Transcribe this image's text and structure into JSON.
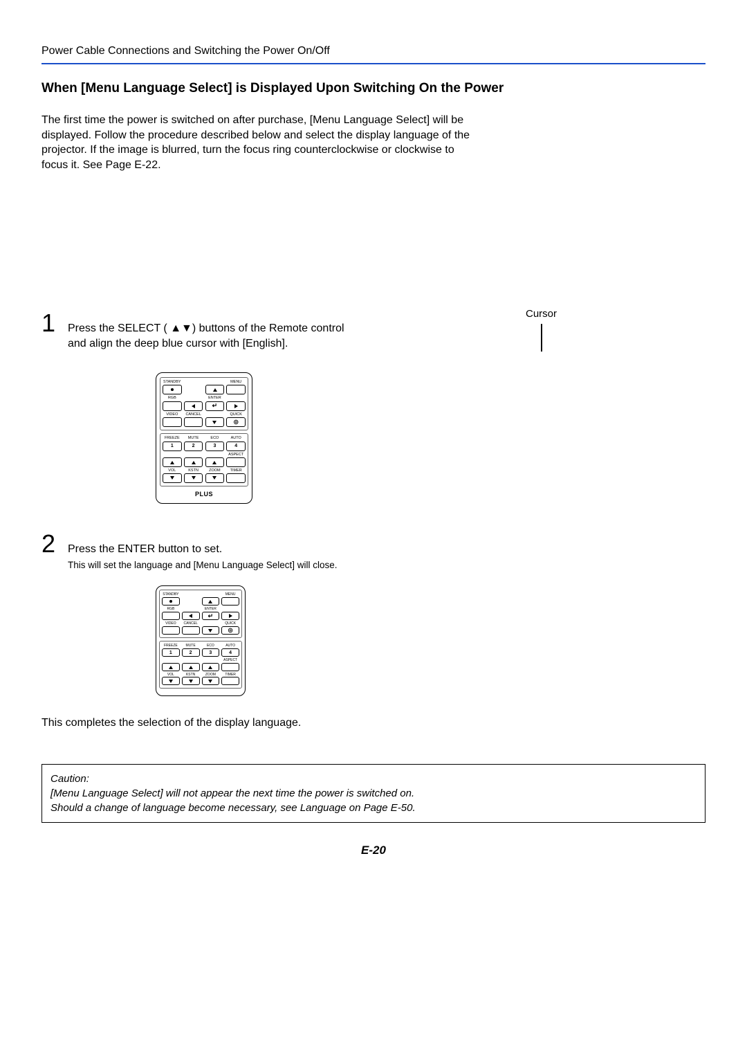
{
  "header": "Power Cable Connections and Switching the Power On/Off",
  "title": "When [Menu Language Select] is Displayed Upon Switching On the Power",
  "intro": "The first time the power is switched on after purchase, [Menu Language Select] will be displayed. Follow the procedure described below and select the display language of the projector.\nIf the image is blurred, turn the focus ring counterclockwise or clockwise to focus it. See Page E-22.",
  "cursor_label": "Cursor",
  "steps": {
    "s1": {
      "num": "1",
      "text": "Press the SELECT ( ▲▼) buttons of the Remote control and align the deep blue cursor with [English]."
    },
    "s2": {
      "num": "2",
      "text": "Press the ENTER button to set.",
      "sub": "This will set the language and [Menu Language Select] will close."
    }
  },
  "remote": {
    "standby": "STANDBY",
    "menu": "MENU",
    "rgb": "RGB",
    "enter": "ENTER",
    "video": "VIDEO",
    "cancel": "CANCEL",
    "quick": "QUICK",
    "freeze": "FREEZE",
    "mute": "MUTE",
    "eco": "ECO",
    "auto": "AUTO",
    "aspect": "ASPECT",
    "vol": "VOL",
    "kstn": "KSTN",
    "zoom": "ZOOM",
    "timer": "TIMER",
    "n1": "1",
    "n2": "2",
    "n3": "3",
    "n4": "4",
    "brand": "PLUS"
  },
  "completion": "This completes the selection of the display language.",
  "caution": {
    "title": "Caution:",
    "line1": "[Menu Language Select] will not appear the next time the power is switched on.",
    "line2a": "Should a change of language become necessary, see",
    "line2b": "Language",
    "line2c": "on Page E-50."
  },
  "page_number": "E-20"
}
